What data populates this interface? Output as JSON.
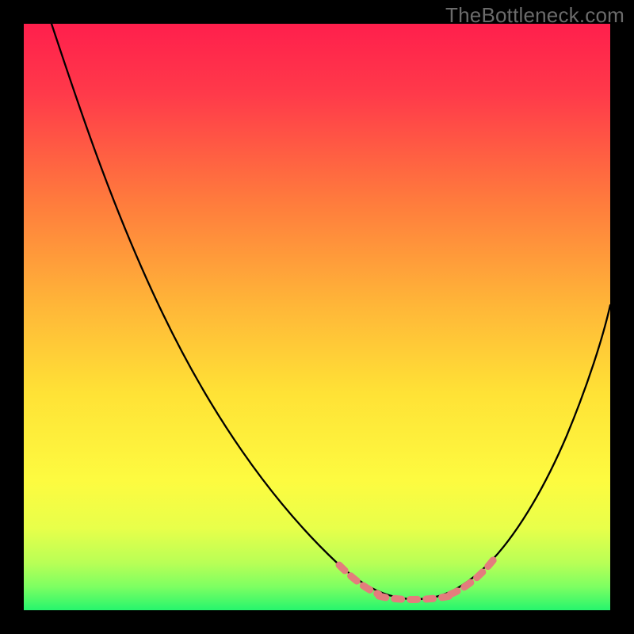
{
  "watermark": "TheBottleneck.com",
  "colors": {
    "background_black": "#000000",
    "curve_black": "#000000",
    "highlight_salmon": "#e37d7d",
    "gradient_stops": [
      "#ff1f4c",
      "#ff3a4a",
      "#ff7a3d",
      "#ffb638",
      "#ffe236",
      "#fdfb40",
      "#e8ff4a",
      "#b8ff56",
      "#7dff62",
      "#26f56d"
    ]
  },
  "chart_data": {
    "type": "line",
    "title": "",
    "xlabel": "",
    "ylabel": "",
    "xlim": [
      0,
      100
    ],
    "ylim": [
      0,
      100
    ],
    "x": [
      5,
      10,
      15,
      20,
      24,
      30,
      36,
      42,
      48,
      53,
      58,
      62,
      66,
      70,
      74,
      78,
      82,
      86,
      90,
      94,
      100
    ],
    "values": [
      100,
      93,
      85,
      76,
      68,
      57,
      46,
      36,
      26,
      18,
      11,
      6,
      3,
      2,
      2,
      4,
      9,
      16,
      25,
      36,
      52
    ],
    "series": [
      {
        "name": "bottleneck-curve",
        "values": [
          100,
          93,
          85,
          76,
          68,
          57,
          46,
          36,
          26,
          18,
          11,
          6,
          3,
          2,
          2,
          4,
          9,
          16,
          25,
          36,
          52
        ]
      }
    ],
    "highlight_range_x": [
      54,
      80
    ],
    "minimum_x": 68,
    "minimum_y": 2,
    "background": "vertical-gradient",
    "legend": false,
    "grid": false
  }
}
